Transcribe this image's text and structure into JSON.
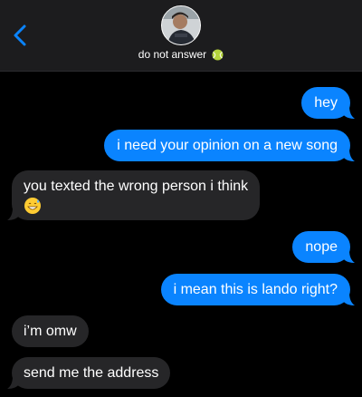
{
  "header": {
    "back_icon": "chevron-left-icon",
    "contact_name": "do not answer",
    "contact_emoji": "tennis-ball-emoji",
    "accent": "#0a84ff",
    "background": "#1c1c1e"
  },
  "messages": [
    {
      "from": "me",
      "text": "hey"
    },
    {
      "from": "me",
      "text": "i need your opinion on a new song"
    },
    {
      "from": "them",
      "text": "you texted the wrong person i think",
      "emoji": "grinning-sweat-emoji"
    },
    {
      "from": "me",
      "text": "nope"
    },
    {
      "from": "me",
      "text": "i mean this is lando right?"
    },
    {
      "from": "them",
      "text": "i’m omw"
    },
    {
      "from": "them",
      "text": "send me the address"
    }
  ],
  "colors": {
    "sent_bubble": "#0a84ff",
    "received_bubble": "#262628",
    "background": "#000000"
  }
}
